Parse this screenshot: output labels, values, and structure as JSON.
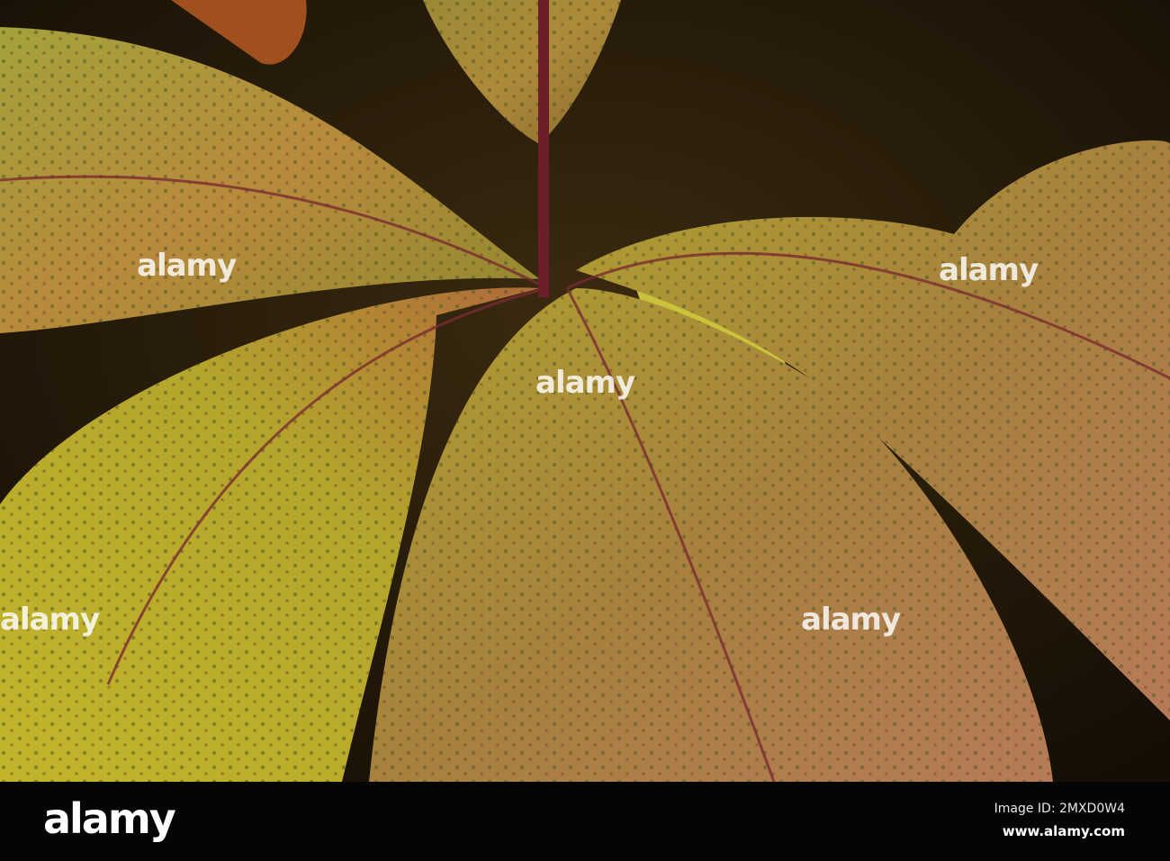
{
  "photo": {
    "subject": "autumn leaves",
    "colors": {
      "background": "#2a1f0c",
      "leaf_yellow": "#b7a62a",
      "leaf_green": "#8c8f2a",
      "leaf_red": "#b0593a",
      "stem": "#7a1f28"
    }
  },
  "watermark": {
    "text": "alamy"
  },
  "footer": {
    "logo": "alamy",
    "image_id": "Image ID: 2MXD0W4",
    "site": "www.alamy.com"
  }
}
